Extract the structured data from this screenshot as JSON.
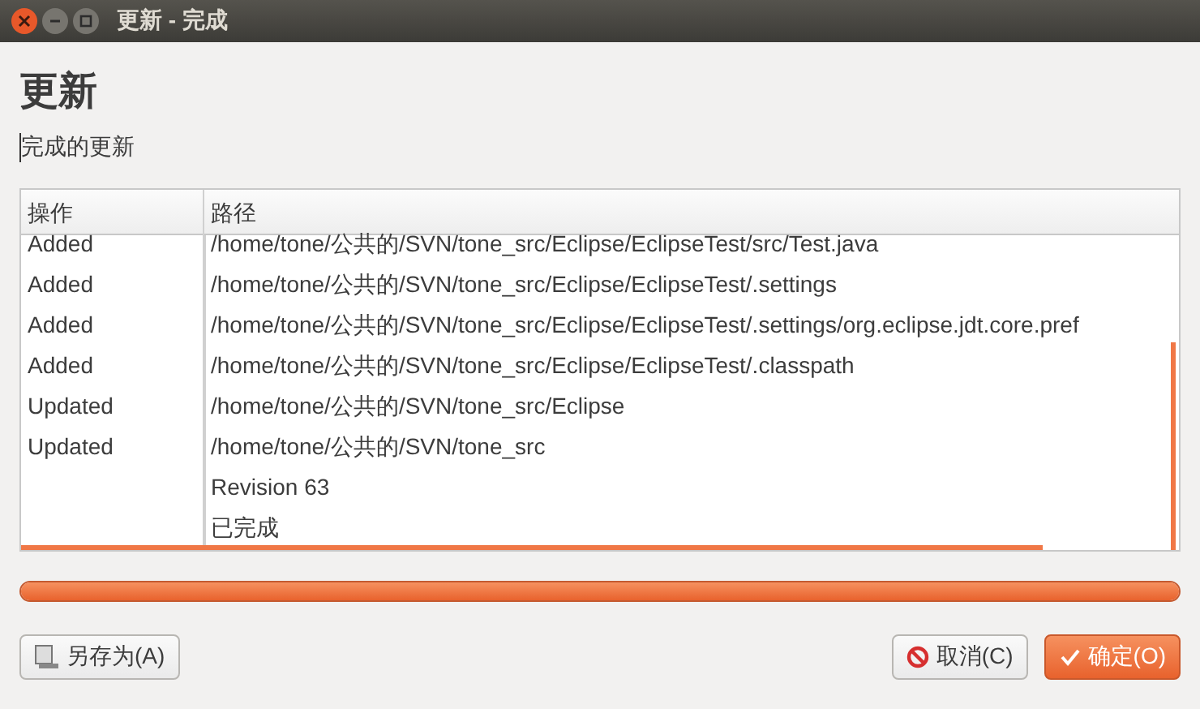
{
  "window": {
    "title": "更新 - 完成"
  },
  "heading": "更新",
  "subtitle": "完成的更新",
  "table": {
    "columns": [
      "操作",
      "路径"
    ],
    "rows": [
      {
        "action": "Added",
        "path": "/home/tone/公共的/SVN/tone_src/Eclipse/EclipseTest/src/Test.java"
      },
      {
        "action": "Added",
        "path": "/home/tone/公共的/SVN/tone_src/Eclipse/EclipseTest/.settings"
      },
      {
        "action": "Added",
        "path": "/home/tone/公共的/SVN/tone_src/Eclipse/EclipseTest/.settings/org.eclipse.jdt.core.pref"
      },
      {
        "action": "Added",
        "path": "/home/tone/公共的/SVN/tone_src/Eclipse/EclipseTest/.classpath"
      },
      {
        "action": "Updated",
        "path": "/home/tone/公共的/SVN/tone_src/Eclipse"
      },
      {
        "action": "Updated",
        "path": "/home/tone/公共的/SVN/tone_src"
      },
      {
        "path": "Revision 63"
      },
      {
        "path": "已完成"
      }
    ]
  },
  "progress": {
    "level": 1
  },
  "buttons": [
    {
      "label": "另存为(A)",
      "kind": "save"
    },
    {
      "label": "取消(C)",
      "kind": "cancel"
    },
    {
      "label": "确定(O)",
      "kind": "ok"
    }
  ]
}
